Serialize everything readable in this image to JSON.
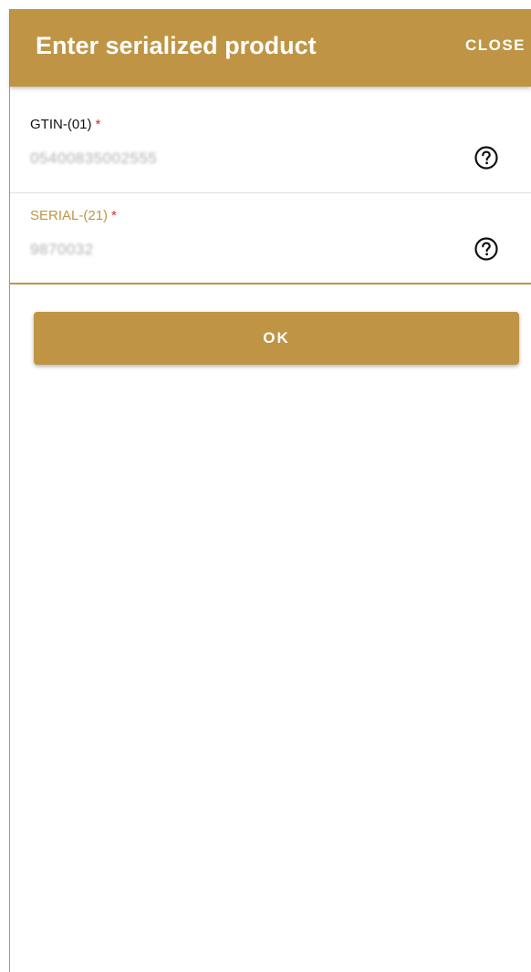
{
  "header": {
    "title": "Enter serialized product",
    "close_label": "CLOSE",
    "background_color": "#bf9545"
  },
  "fields": [
    {
      "label": "GTIN-(01)",
      "required_mark": "*",
      "value": "05400835002555",
      "help_icon": "help-circle-icon"
    },
    {
      "label": "SERIAL-(21)",
      "required_mark": "*",
      "value": "9870032",
      "help_icon": "help-circle-icon",
      "focused": true
    }
  ],
  "actions": {
    "ok_label": "OK"
  },
  "colors": {
    "accent": "#bf9545",
    "required": "#d12c2c"
  }
}
